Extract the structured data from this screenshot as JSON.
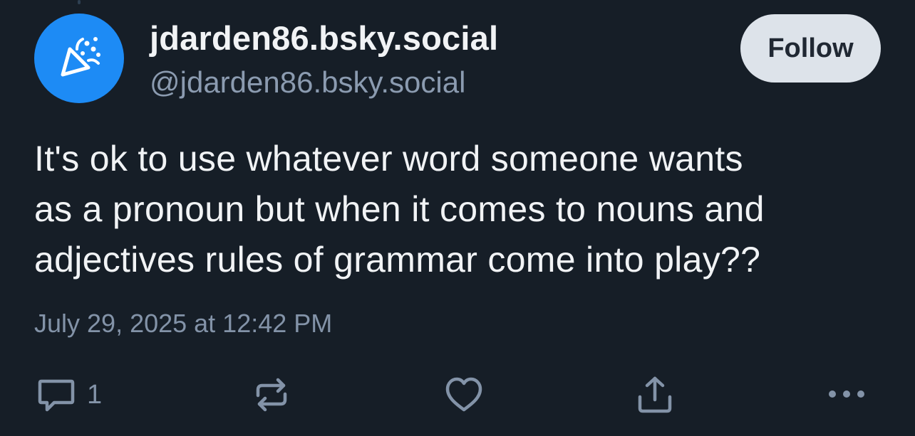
{
  "author": {
    "display_name": "jdarden86.bsky.social",
    "handle": "@jdarden86.bsky.social",
    "avatar_icon": "party-popper-icon",
    "avatar_color": "#1d8bf5"
  },
  "follow_label": "Follow",
  "post": {
    "text": "It's ok to use whatever word someone wants\nas a pronoun but when it comes to nouns and\nadjectives rules of grammar come into play??",
    "timestamp": "July 29, 2025 at 12:42 PM"
  },
  "actions": {
    "reply_count": "1",
    "reply_icon": "reply-icon",
    "repost_icon": "repost-icon",
    "like_icon": "heart-icon",
    "share_icon": "share-icon",
    "more_icon": "more-options-icon"
  },
  "colors": {
    "background": "#161e27",
    "muted_text": "#8393a8",
    "button_bg": "#dde3ea"
  }
}
